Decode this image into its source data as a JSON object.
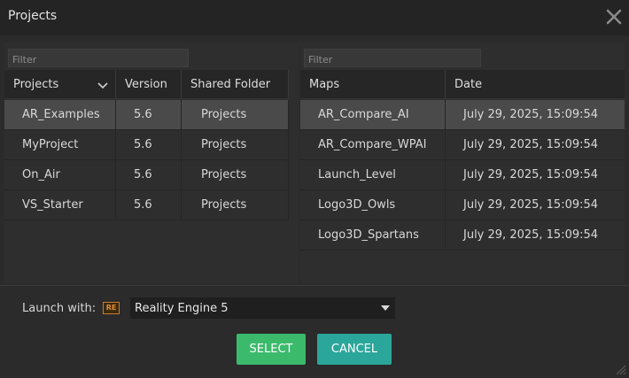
{
  "window": {
    "title": "Projects",
    "close_icon": "close-icon"
  },
  "projects": {
    "filter_placeholder": "Filter",
    "columns": [
      "Projects",
      "Version",
      "Shared Folder"
    ],
    "rows": [
      {
        "name": "AR_Examples",
        "version": "5.6",
        "folder": "Projects",
        "selected": true
      },
      {
        "name": "MyProject",
        "version": "5.6",
        "folder": "Projects"
      },
      {
        "name": "On_Air",
        "version": "5.6",
        "folder": "Projects"
      },
      {
        "name": "VS_Starter",
        "version": "5.6",
        "folder": "Projects"
      }
    ]
  },
  "maps": {
    "filter_placeholder": "Filter",
    "columns": [
      "Maps",
      "Date"
    ],
    "rows": [
      {
        "name": "AR_Compare_AI",
        "date": "July 29, 2025, 15:09:54",
        "selected": true
      },
      {
        "name": "AR_Compare_WPAI",
        "date": "July 29, 2025, 15:09:54"
      },
      {
        "name": "Launch_Level",
        "date": "July 29, 2025, 15:09:54"
      },
      {
        "name": "Logo3D_Owls",
        "date": "July 29, 2025, 15:09:54"
      },
      {
        "name": "Logo3D_Spartans",
        "date": "July 29, 2025, 15:09:54"
      }
    ]
  },
  "launch": {
    "label": "Launch with:",
    "engine_icon_text": "RE",
    "selected": "Reality Engine 5"
  },
  "buttons": {
    "select": "SELECT",
    "cancel": "CANCEL"
  },
  "colors": {
    "select": "#3bba6c",
    "cancel": "#2aa69a",
    "accent": "#e08a32"
  }
}
